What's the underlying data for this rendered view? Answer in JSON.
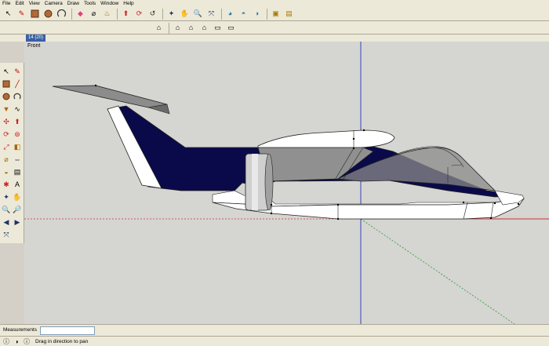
{
  "menu": [
    "File",
    "Edit",
    "View",
    "Camera",
    "Draw",
    "Tools",
    "Window",
    "Help"
  ],
  "toolbar1_icons": [
    "select-icon",
    "pencil-icon",
    "rectangle-icon",
    "circle-icon",
    "arc-icon",
    "eraser-icon",
    "tape-measure-icon",
    "paint-bucket-icon",
    "push-pull-icon",
    "rotate-icon",
    "follow-me-icon",
    "orbit-icon",
    "pan-icon",
    "zoom-icon",
    "zoom-extents-icon",
    "google-earth-icon",
    "get-models-icon",
    "share-model-icon",
    "components-icon",
    "dynamic-components-icon"
  ],
  "toolbar2_icons": [
    "iso-view-icon",
    "top-view-icon",
    "front-view-icon",
    "right-view-icon",
    "back-view-icon",
    "left-view-icon"
  ],
  "scene_tab": "14 (20)",
  "view_label": "Front",
  "left_toolbar_icons": [
    "select-icon",
    "pencil-icon",
    "rectangle-icon",
    "line-icon",
    "circle-icon",
    "arc-icon",
    "polygon-icon",
    "freehand-icon",
    "move-icon",
    "push-pull-icon",
    "rotate-icon",
    "follow-me-icon",
    "scale-icon",
    "offset-icon",
    "tape-measure-icon",
    "dimension-icon",
    "protractor-icon",
    "text-icon",
    "axes-icon",
    "3d-text-icon",
    "orbit-icon",
    "pan-icon",
    "zoom-icon",
    "zoom-window-icon",
    "previous-view-icon",
    "next-view-icon",
    "zoom-extents-icon"
  ],
  "measurements_label": "Measurements",
  "measurements_value": "",
  "status_text": "Drag in direction to pan"
}
